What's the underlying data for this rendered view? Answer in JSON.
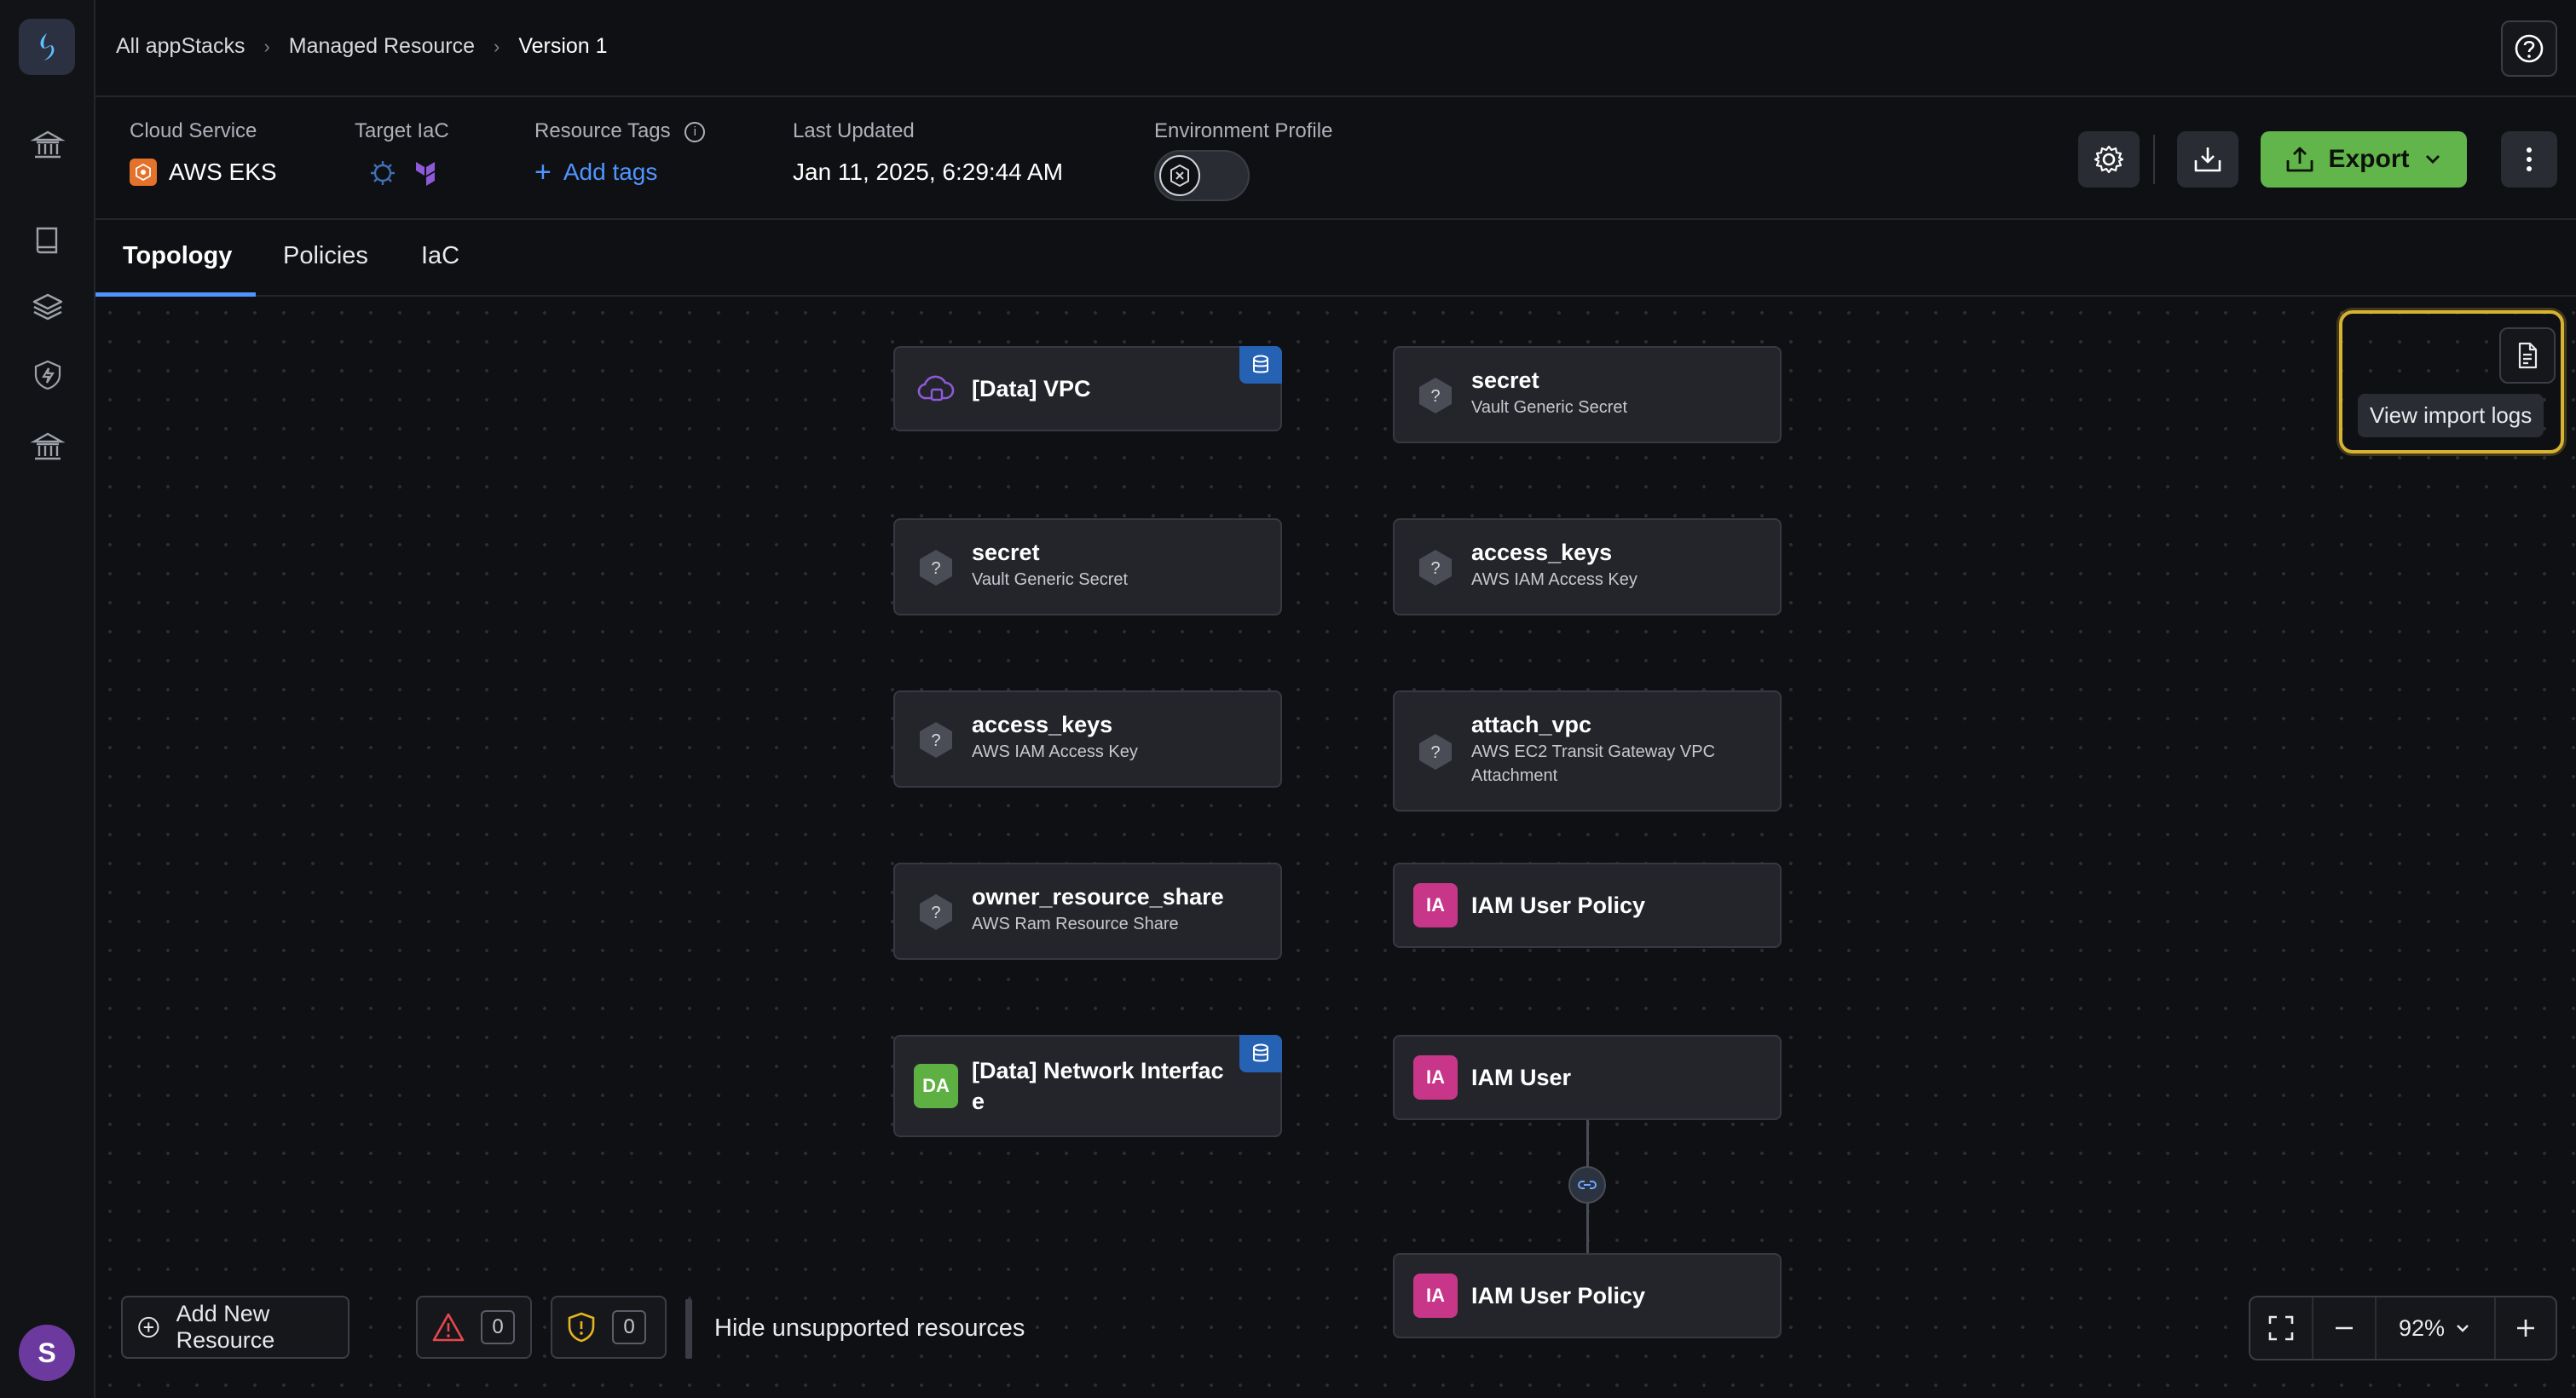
{
  "sidebar": {
    "avatar_initial": "S"
  },
  "breadcrumb": {
    "items": [
      "All appStacks",
      "Managed Resource",
      "Version 1"
    ]
  },
  "info": {
    "cloud_service_label": "Cloud Service",
    "cloud_service_value": "AWS EKS",
    "target_iac_label": "Target IaC",
    "resource_tags_label": "Resource Tags",
    "add_tags": "Add tags",
    "last_updated_label": "Last Updated",
    "last_updated_value": "Jan 11, 2025, 6:29:44 AM",
    "environment_profile_label": "Environment Profile"
  },
  "toolbar": {
    "export_label": "Export"
  },
  "tabs": [
    "Topology",
    "Policies",
    "IaC"
  ],
  "nodes": {
    "n1": {
      "title": "[Data] VPC"
    },
    "n2": {
      "title": "secret",
      "sub": "Vault Generic Secret"
    },
    "n3": {
      "title": "secret",
      "sub": "Vault Generic Secret"
    },
    "n4": {
      "title": "access_keys",
      "sub": "AWS IAM Access Key"
    },
    "n5": {
      "title": "access_keys",
      "sub": "AWS IAM Access Key"
    },
    "n6": {
      "title": "attach_vpc",
      "sub": "AWS EC2 Transit Gateway VPC Attachment"
    },
    "n7": {
      "title": "owner_resource_share",
      "sub": "AWS Ram Resource Share"
    },
    "n8": {
      "title": "IAM User Policy",
      "badge": "IA"
    },
    "n9": {
      "title": "[Data] Network Interface",
      "badge": "DA"
    },
    "n10": {
      "title": "IAM User",
      "badge": "IA"
    },
    "n11": {
      "title": "IAM User Policy",
      "badge": "IA"
    }
  },
  "import_logs": {
    "tooltip": "View import logs"
  },
  "bottom": {
    "add_resource": "Add New Resource",
    "warnings_count": "0",
    "policy_count": "0",
    "hide_unsupported": "Hide unsupported resources"
  },
  "zoom": {
    "level": "92%"
  },
  "colors": {
    "accent": "#4f95ff",
    "export": "#62b54b",
    "iam_badge": "#c8368a",
    "data_badge": "#5fb043",
    "highlight": "#d7b233"
  }
}
